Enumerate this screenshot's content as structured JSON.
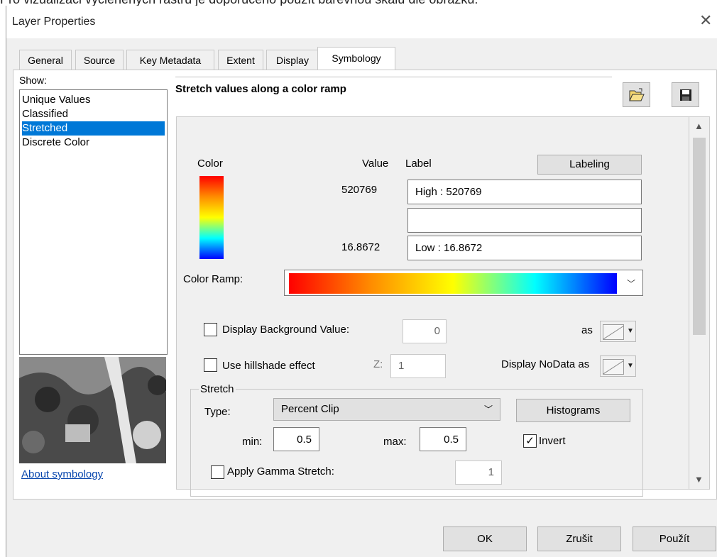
{
  "top_text": "Pro vizualizaci vyčleněných rastrů je doporučeno použít barevnou škálu dle obrázku:",
  "window": {
    "title": "Layer Properties",
    "close": "✕"
  },
  "tabs": [
    "General",
    "Source",
    "Key Metadata",
    "Extent",
    "Display",
    "Symbology"
  ],
  "show": {
    "label": "Show:",
    "items": [
      "Unique Values",
      "Classified",
      "Stretched",
      "Discrete Color"
    ],
    "selected": "Stretched"
  },
  "about_link": "About symbology",
  "heading": "Stretch values along a color ramp",
  "icons": {
    "open": "folder-open-icon",
    "save": "floppy-disk-icon"
  },
  "color_section": {
    "color_label": "Color",
    "value_label": "Value",
    "label_label": "Label",
    "labeling_button": "Labeling",
    "high_value": "520769",
    "high_label": "High : 520769",
    "mid_label": "",
    "low_value": "16.8672",
    "low_label": "Low : 16.8672"
  },
  "color_ramp": {
    "label": "Color Ramp:",
    "colors": [
      "#ff0000",
      "#ff8c00",
      "#ffff00",
      "#00ffff",
      "#0000ff"
    ]
  },
  "background": {
    "label": "Display Background Value:",
    "value": "0",
    "as_label": "as",
    "checked": false
  },
  "hillshade": {
    "label": "Use hillshade effect",
    "z_label": "Z:",
    "z_value": "1",
    "nodata_label": "Display NoData as",
    "checked": false
  },
  "stretch": {
    "group_label": "Stretch",
    "type_label": "Type:",
    "type_value": "Percent Clip",
    "histograms_button": "Histograms",
    "min_label": "min:",
    "min_value": "0.5",
    "max_label": "max:",
    "max_value": "0.5",
    "invert_label": "Invert",
    "invert_checked": true,
    "gamma_label": "Apply Gamma Stretch:",
    "gamma_value": "1",
    "gamma_checked": false
  },
  "buttons": {
    "ok": "OK",
    "cancel": "Zrušit",
    "apply": "Použít"
  }
}
